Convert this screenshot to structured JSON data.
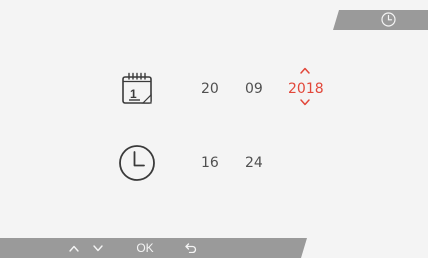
{
  "date": {
    "day": "20",
    "month": "09",
    "year": "2018"
  },
  "time": {
    "hours": "16",
    "minutes": "24"
  },
  "nav": {
    "ok_label": "OK"
  },
  "icons": {
    "top_tab": "clock-icon",
    "date": "calendar-icon",
    "time": "clock-icon",
    "up": "chevron-up-icon",
    "down": "chevron-down-icon",
    "back": "back-arrow-icon"
  },
  "colors": {
    "background": "#f4f4f4",
    "bar": "#9a9a9a",
    "text": "#505050",
    "accent": "#e2473a"
  }
}
